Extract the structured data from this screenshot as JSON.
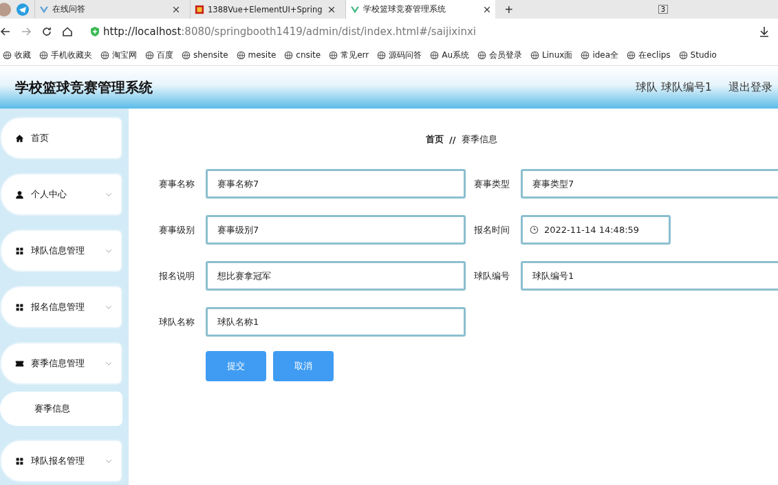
{
  "browser": {
    "tabs": [
      {
        "title": "在线问答",
        "selected": false
      },
      {
        "title": "1388Vue+ElementUI+Spring",
        "selected": false
      },
      {
        "title": "学校篮球竞赛管理系统",
        "selected": true
      }
    ],
    "new_tab": "+",
    "window_count": "3",
    "url_host": "http://localhost",
    "url_rest": ":8080/springbooth1419/admin/dist/index.html#/saijixinxi",
    "bookmarks": [
      "收藏",
      "手机收藏夹",
      "淘宝网",
      "百度",
      "shensite",
      "mesite",
      "cnsite",
      "常见err",
      "源码问答",
      "Au系统",
      "会员登录",
      "Linux面",
      "idea全",
      "在eclips",
      "Studio"
    ]
  },
  "app": {
    "title": "学校篮球竞赛管理系统",
    "user": "球队 球队编号1",
    "logout": "退出登录"
  },
  "sidebar": {
    "items": [
      {
        "label": "首页",
        "kind": "link"
      },
      {
        "label": "个人中心",
        "kind": "submenu"
      },
      {
        "label": "球队信息管理",
        "kind": "submenu"
      },
      {
        "label": "报名信息管理",
        "kind": "submenu"
      },
      {
        "label": "赛季信息管理",
        "kind": "submenu",
        "children": [
          {
            "label": "赛季信息"
          }
        ]
      },
      {
        "label": "球队报名管理",
        "kind": "submenu"
      }
    ]
  },
  "breadcrumb": {
    "items": [
      "首页",
      "赛季信息"
    ],
    "separator": "//"
  },
  "form": {
    "fields": [
      {
        "label": "赛事名称",
        "value": "赛事名称7",
        "kind": "text"
      },
      {
        "label": "赛事类型",
        "value": "赛事类型7",
        "kind": "text"
      },
      {
        "label": "赛事级别",
        "value": "赛事级别7",
        "kind": "text"
      },
      {
        "label": "报名时间",
        "value": "2022-11-14 14:48:59",
        "kind": "datetime"
      },
      {
        "label": "报名说明",
        "value": "想比赛拿冠军",
        "kind": "text"
      },
      {
        "label": "球队编号",
        "value": "球队编号1",
        "kind": "text"
      },
      {
        "label": "球队名称",
        "value": "球队名称1",
        "kind": "text"
      }
    ],
    "buttons": [
      "提交",
      "取消"
    ]
  }
}
